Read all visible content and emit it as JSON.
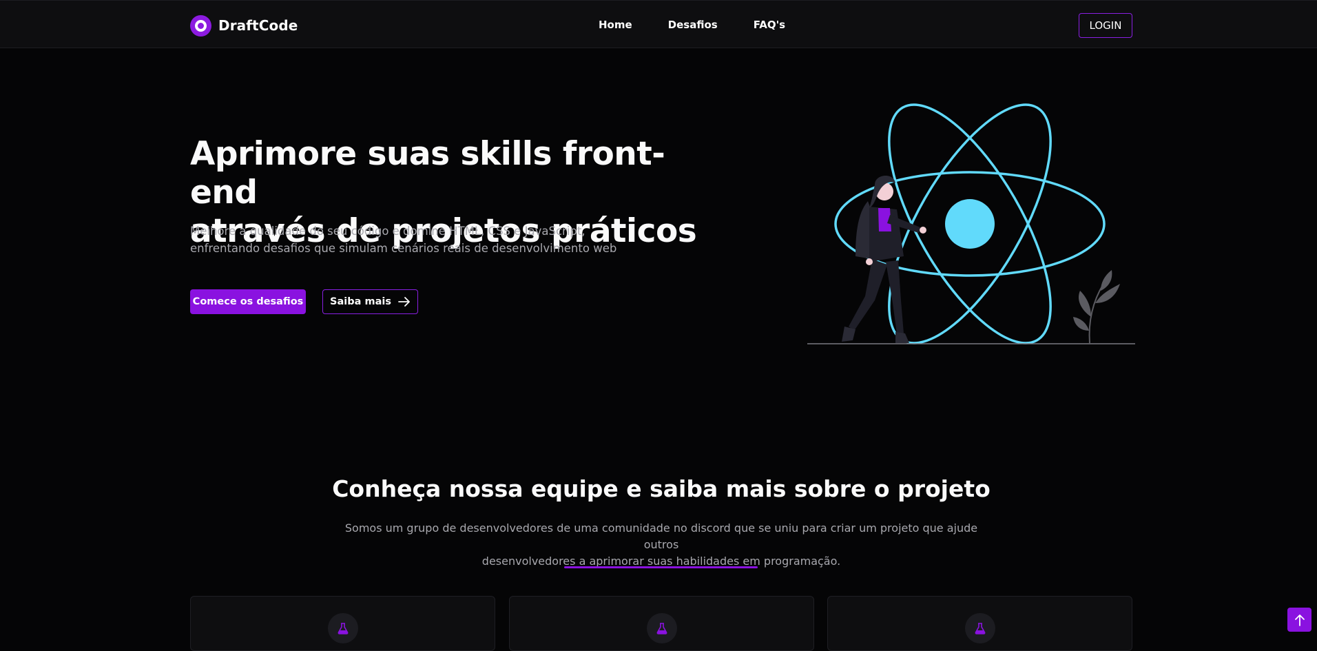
{
  "navbar": {
    "brand": "DraftCode",
    "links": [
      "Home",
      "Desafios",
      "FAQ's"
    ],
    "login": "LOGIN"
  },
  "hero": {
    "title_line1": "Aprimore suas skills front-end",
    "title_line2": "através de projetos práticos",
    "subtitle_line1": "Melhore a qualidade do seu código e domine HTML, CSS e JavaScript,",
    "subtitle_line2": "enfrentando desafios que simulam cenários reais de desenvolvimento web",
    "primary_button": "Comece os desafios",
    "secondary_button": "Saiba mais"
  },
  "about": {
    "title": "Conheça nossa equipe e saiba mais sobre o projeto",
    "subtitle_line1": "Somos um grupo de desenvolvedores de uma comunidade no discord que se uniu para criar um projeto que ajude outros",
    "subtitle_line2": "desenvolvedores a aprimorar suas habilidades em programação."
  },
  "cards": [
    {
      "icon": "flask-icon"
    },
    {
      "icon": "flask-icon"
    },
    {
      "icon": "flask-icon"
    }
  ],
  "colors": {
    "accent": "#8a12e0",
    "background": "#050506",
    "react_blue": "#61dafb"
  }
}
